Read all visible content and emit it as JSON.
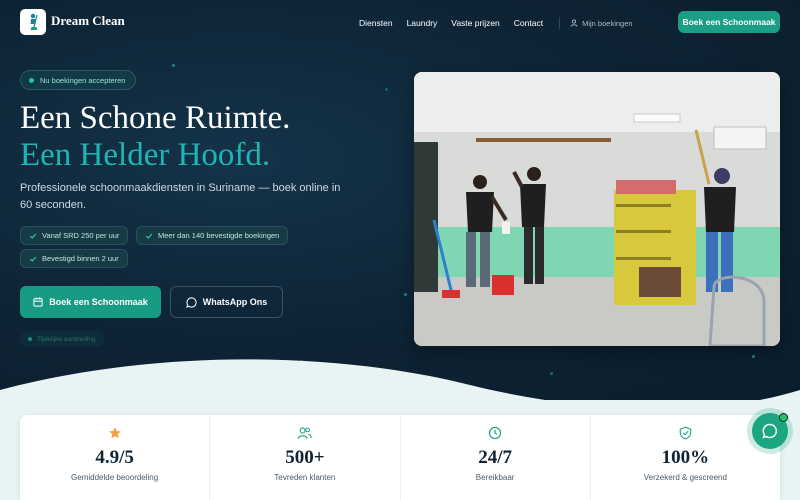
{
  "brand": {
    "name": "Dream Clean"
  },
  "nav": {
    "links": [
      "Diensten",
      "Laundry",
      "Vaste prijzen",
      "Contact"
    ],
    "account_label": "Mijn boekingen",
    "cta_label": "Boek een Schoonmaak"
  },
  "hero": {
    "badge": "Nu boekingen accepteren",
    "title_line1": "Een Schone Ruimte.",
    "title_line2": "Een Helder Hoofd.",
    "subtitle": "Professionele schoonmaakdiensten in Suriname — boek online in 60 seconden.",
    "chips": [
      "Vanaf SRD 250 per uur",
      "Meer dan 140 bevestigde boekingen",
      "Bevestigd binnen 2 uur"
    ],
    "primary_cta": "Boek een Schoonmaak",
    "secondary_cta": "WhatsApp Ons",
    "faint_note": "Tijdelijke aanbieding"
  },
  "stats": [
    {
      "icon": "star-icon",
      "value": "4.9/5",
      "label": "Gemiddelde beoordeling"
    },
    {
      "icon": "users-icon",
      "value": "500+",
      "label": "Tevreden klanten"
    },
    {
      "icon": "clock-icon",
      "value": "24/7",
      "label": "Bereikbaar"
    },
    {
      "icon": "shield-check-icon",
      "value": "100%",
      "label": "Verzekerd & gescreend"
    }
  ],
  "colors": {
    "background": "#0e2334",
    "accent": "#1a9e86",
    "title_accent": "#1eb6b4",
    "star": "#f59e42"
  }
}
